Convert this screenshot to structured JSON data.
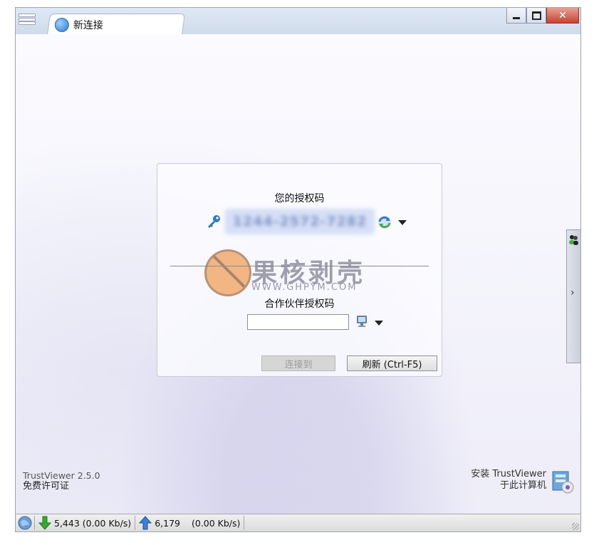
{
  "window": {
    "tab_label": "新连接",
    "minimize_label": "—",
    "maximize_label": "☐",
    "close_label": "✕"
  },
  "panel": {
    "auth_title": "您的授权码",
    "auth_code": "1244-2572-7282",
    "partner_title": "合作伙伴授权码",
    "partner_value": "",
    "connect_label": "连接到",
    "refresh_label": "刷新 (Ctrl-F5)"
  },
  "watermark": {
    "title": "果核剥壳",
    "url": "WWW.GHPYM.COM"
  },
  "side_panel": {
    "chevron": "›"
  },
  "footer": {
    "version": "TrustViewer 2.5.0",
    "license": "免费许可证",
    "install_line1": "安装 TrustViewer",
    "install_line2": "于此计算机"
  },
  "status": {
    "download": "5,443 (0.00 Kb/s)",
    "upload_count": "6,179",
    "upload_rate": "(0.00 Kb/s)"
  },
  "colors": {
    "accent_blue": "#2d79c8",
    "download_green": "#3aa635",
    "upload_blue": "#3f7fd6"
  }
}
